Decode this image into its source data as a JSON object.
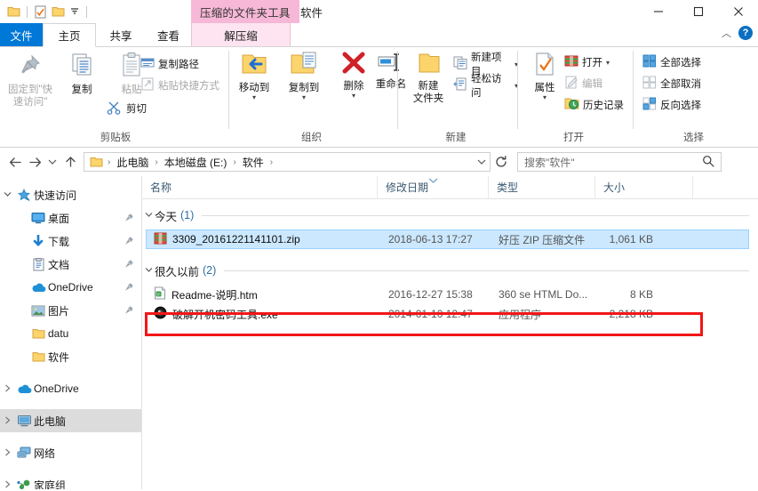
{
  "window": {
    "title": "软件",
    "contextual_tab_header": "压缩的文件夹工具",
    "quick_access": [
      {
        "name": "folder-icon",
        "label": "属性"
      },
      {
        "name": "properties-icon",
        "label": "属性"
      },
      {
        "name": "new-folder-icon",
        "label": "新建文件夹"
      },
      {
        "name": "customize-dropdown",
        "label": "▾"
      }
    ],
    "controls": {
      "minimize": "—",
      "maximize": "□",
      "close": "✕",
      "collapse": "︿",
      "help": "?"
    }
  },
  "tabs": [
    {
      "id": "file",
      "label": "文件"
    },
    {
      "id": "home",
      "label": "主页"
    },
    {
      "id": "share",
      "label": "共享"
    },
    {
      "id": "view",
      "label": "查看"
    },
    {
      "id": "extract",
      "label": "解压缩"
    }
  ],
  "ribbon": {
    "groups": [
      {
        "id": "clipboard",
        "label": "剪贴板",
        "big_buttons": [
          {
            "name": "pin-to-quick-access",
            "label": "固定到\"快速访问\"",
            "disabled": true
          },
          {
            "name": "copy",
            "label": "复制",
            "disabled": false
          },
          {
            "name": "paste",
            "label": "粘贴",
            "disabled": true
          }
        ],
        "small_buttons": [
          {
            "name": "copy-path",
            "label": "复制路径",
            "disabled": false
          },
          {
            "name": "paste-shortcut",
            "label": "粘贴快捷方式",
            "disabled": true
          },
          {
            "name": "cut",
            "label": "剪切",
            "disabled": false
          }
        ]
      },
      {
        "id": "organize",
        "label": "组织",
        "big_buttons": [
          {
            "name": "move-to",
            "label": "移动到",
            "has_caret": true
          },
          {
            "name": "copy-to",
            "label": "复制到",
            "has_caret": true
          },
          {
            "name": "delete",
            "label": "删除",
            "has_caret": true
          },
          {
            "name": "rename",
            "label": "重命名",
            "has_caret": false
          }
        ]
      },
      {
        "id": "new",
        "label": "新建",
        "big_buttons": [
          {
            "name": "new-folder",
            "label": "新建\n文件夹",
            "has_caret": false
          }
        ],
        "small_buttons": [
          {
            "name": "new-item",
            "label": "新建项目",
            "has_caret": true
          },
          {
            "name": "easy-access",
            "label": "轻松访问",
            "has_caret": true
          }
        ]
      },
      {
        "id": "open",
        "label": "打开",
        "big_buttons": [
          {
            "name": "properties",
            "label": "属性",
            "has_caret": true
          }
        ],
        "small_buttons": [
          {
            "name": "open",
            "label": "打开",
            "has_caret": true,
            "disabled": false
          },
          {
            "name": "edit",
            "label": "编辑",
            "disabled": true
          },
          {
            "name": "history",
            "label": "历史记录",
            "disabled": false
          }
        ]
      },
      {
        "id": "select",
        "label": "选择",
        "small_buttons": [
          {
            "name": "select-all",
            "label": "全部选择"
          },
          {
            "name": "select-none",
            "label": "全部取消"
          },
          {
            "name": "invert-selection",
            "label": "反向选择"
          }
        ]
      }
    ]
  },
  "addressbar": {
    "back": "←",
    "forward": "→",
    "recent": "˅",
    "up": "↑",
    "breadcrumbs": [
      "此电脑",
      "本地磁盘 (E:)",
      "软件"
    ],
    "dropdown": "˅",
    "refresh": "↻",
    "search_placeholder": "搜索\"软件\"",
    "search_value": "",
    "search_icon": "search-icon"
  },
  "sidebar": {
    "items": [
      {
        "label": "快速访问",
        "icon": "star-pin-icon",
        "expander": "˅",
        "indent": 0,
        "pinned": false,
        "selected": false
      },
      {
        "label": "桌面",
        "icon": "desktop-icon",
        "expander": "",
        "indent": 1,
        "pinned": true,
        "selected": false
      },
      {
        "label": "下载",
        "icon": "download-icon",
        "expander": "",
        "indent": 1,
        "pinned": true,
        "selected": false
      },
      {
        "label": "文档",
        "icon": "documents-icon",
        "expander": "",
        "indent": 1,
        "pinned": true,
        "selected": false
      },
      {
        "label": "OneDrive",
        "icon": "onedrive-cloud-icon",
        "expander": "",
        "indent": 1,
        "pinned": true,
        "selected": false
      },
      {
        "label": "图片",
        "icon": "pictures-icon",
        "expander": "",
        "indent": 1,
        "pinned": true,
        "selected": false
      },
      {
        "label": "datu",
        "icon": "folder-icon",
        "expander": "",
        "indent": 1,
        "pinned": false,
        "selected": false
      },
      {
        "label": "软件",
        "icon": "folder-icon",
        "expander": "",
        "indent": 1,
        "pinned": false,
        "selected": false
      },
      {
        "label": "OneDrive",
        "icon": "onedrive-cloud-icon",
        "expander": "›",
        "indent": 0,
        "pinned": false,
        "selected": false
      },
      {
        "label": "此电脑",
        "icon": "this-pc-icon",
        "expander": "›",
        "indent": 0,
        "pinned": false,
        "selected": true
      },
      {
        "label": "网络",
        "icon": "network-icon",
        "expander": "›",
        "indent": 0,
        "pinned": false,
        "selected": false
      },
      {
        "label": "家庭组",
        "icon": "homegroup-icon",
        "expander": "›",
        "indent": 0,
        "pinned": false,
        "selected": false
      }
    ]
  },
  "filelist": {
    "columns": [
      {
        "label": "名称",
        "key": "name"
      },
      {
        "label": "修改日期",
        "key": "date",
        "sorted": true,
        "sort_dir": "desc"
      },
      {
        "label": "类型",
        "key": "type"
      },
      {
        "label": "大小",
        "key": "size"
      }
    ],
    "groups": [
      {
        "chevron": "˅",
        "name": "今天",
        "count": "(1)",
        "rows": [
          {
            "name": "3309_20161221141101.zip",
            "date": "2018-06-13 17:27",
            "type": "好压 ZIP 压缩文件",
            "size": "1,061 KB",
            "icon": "zip-archive-icon",
            "selected": true,
            "highlighted": false
          }
        ]
      },
      {
        "chevron": "˅",
        "name": "很久以前",
        "count": "(2)",
        "rows": [
          {
            "name": "Readme-说明.htm",
            "date": "2016-12-27 15:38",
            "type": "360 se HTML Do...",
            "size": "8 KB",
            "icon": "html-document-icon",
            "selected": false,
            "highlighted": false
          },
          {
            "name": "破解开机密码工具.exe",
            "date": "2014-01-10 12:47",
            "type": "应用程序",
            "size": "2,218 KB",
            "icon": "application-exe-icon",
            "selected": false,
            "highlighted": true
          }
        ]
      }
    ]
  },
  "annotation": {
    "color": "#f21616",
    "target": "破解开机密码工具.exe"
  }
}
